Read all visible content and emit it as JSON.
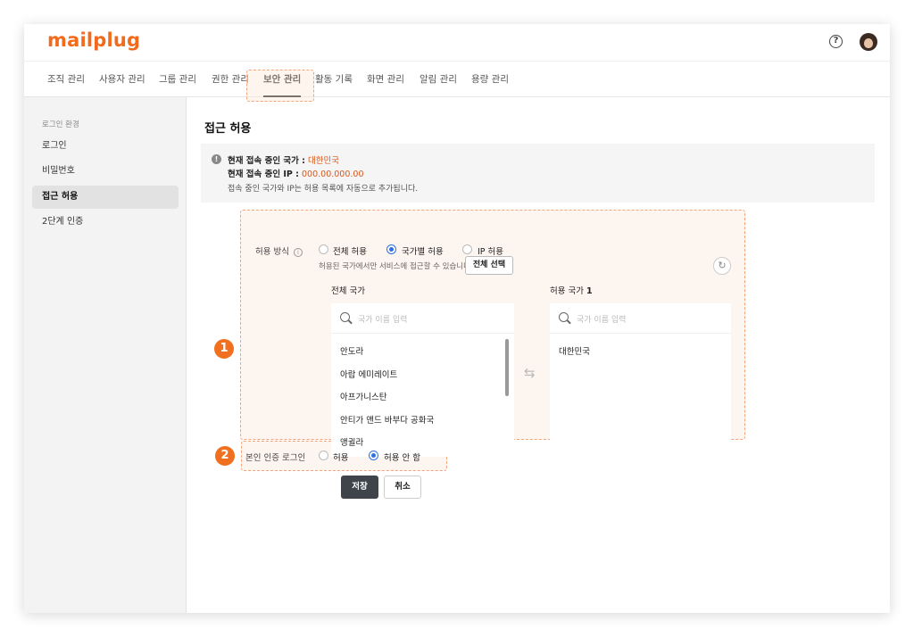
{
  "header": {
    "logo": "mailplug",
    "help_icon_text": "?"
  },
  "tabs": [
    {
      "label": "조직 관리"
    },
    {
      "label": "사용자 관리"
    },
    {
      "label": "그룹 관리"
    },
    {
      "label": "권한 관리"
    },
    {
      "label": "보안 관리",
      "active": true
    },
    {
      "label": "활동 기록"
    },
    {
      "label": "화면 관리"
    },
    {
      "label": "알림 관리"
    },
    {
      "label": "용량 관리"
    }
  ],
  "sidebar": {
    "section": "로그인 환경",
    "items": [
      {
        "label": "로그인"
      },
      {
        "label": "비밀번호"
      },
      {
        "label": "접근 허용",
        "active": true
      },
      {
        "label": "2단계 인증"
      }
    ]
  },
  "main": {
    "title": "접근 허용",
    "info": {
      "country_label": "현재 접속 중인 국가 :",
      "country_value": "대한민국",
      "ip_label": "현재 접속 중인 IP :",
      "ip_value": "000.00.000.00",
      "note": "접속 중인 국가와 IP는 허용 목록에 자동으로 추가됩니다."
    },
    "badges": [
      "1",
      "2"
    ],
    "allow_method": {
      "label": "허용 방식",
      "options": [
        "전체 허용",
        "국가별 허용",
        "IP 허용"
      ],
      "selected": "국가별 허용",
      "hint": "허용된 국가에서만 서비스에 접근할 수 있습니다."
    },
    "all_countries": {
      "title": "전체 국가",
      "select_all": "전체 선택",
      "search_placeholder": "국가 이름 입력",
      "items": [
        "안도라",
        "아랍 에미레이트",
        "아프가니스탄",
        "안티가 앤드 바부다 공화국",
        "앵귈라"
      ]
    },
    "allowed_countries": {
      "title": "허용 국가",
      "count": "1",
      "search_placeholder": "국가 이름 입력",
      "items": [
        "대한민국"
      ]
    },
    "self_auth": {
      "label": "본인 인증 로그인",
      "options": [
        "허용",
        "허용 안 함"
      ],
      "selected": "허용 안 함"
    },
    "buttons": {
      "save": "저장",
      "cancel": "취소"
    }
  },
  "colors": {
    "brand": "#f26b1d",
    "accent": "#d8571b",
    "radio": "#2f6fe0",
    "badge": "#f0701f"
  }
}
